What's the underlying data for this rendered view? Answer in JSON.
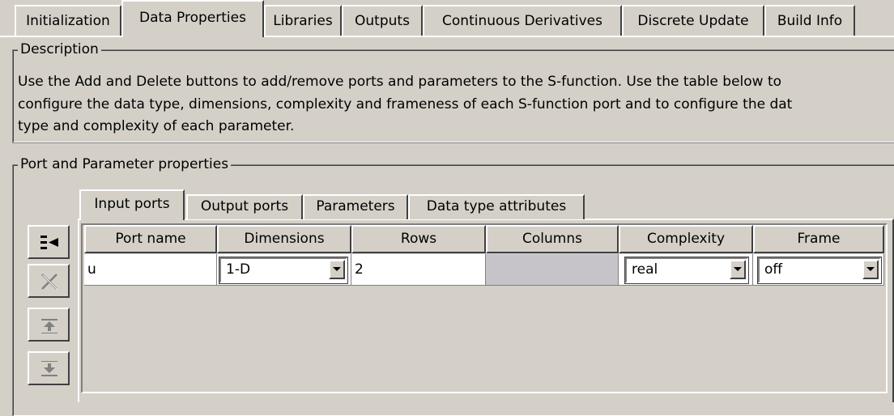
{
  "top_tabs": [
    {
      "label": "Initialization"
    },
    {
      "label": "Data Properties"
    },
    {
      "label": "Libraries"
    },
    {
      "label": "Outputs"
    },
    {
      "label": "Continuous Derivatives"
    },
    {
      "label": "Discrete Update"
    },
    {
      "label": "Build Info"
    }
  ],
  "active_top_tab": "Data Properties",
  "description": {
    "legend": "Description",
    "text": "Use the Add and Delete buttons to add/remove ports and parameters to the S-function. Use the table below to\nconfigure the data type, dimensions, complexity and frameness of each S-function port and to configure the dat\ntype and complexity of each parameter."
  },
  "port_params": {
    "legend": "Port and Parameter properties",
    "tabs": [
      {
        "label": "Input ports"
      },
      {
        "label": "Output ports"
      },
      {
        "label": "Parameters"
      },
      {
        "label": "Data type attributes"
      }
    ],
    "active_tab": "Input ports",
    "toolbar": [
      {
        "name": "add-port-button",
        "icon": "add-row-icon"
      },
      {
        "name": "delete-port-button",
        "icon": "delete-icon"
      },
      {
        "name": "move-up-button",
        "icon": "move-up-icon"
      },
      {
        "name": "move-down-button",
        "icon": "move-down-icon"
      }
    ],
    "table": {
      "columns": [
        "Port name",
        "Dimensions",
        "Rows",
        "Columns",
        "Complexity",
        "Frame"
      ],
      "rows": [
        {
          "port_name": "u",
          "dimensions": "1-D",
          "rows": "2",
          "columns": "",
          "complexity": "real",
          "frame": "off"
        }
      ]
    }
  }
}
